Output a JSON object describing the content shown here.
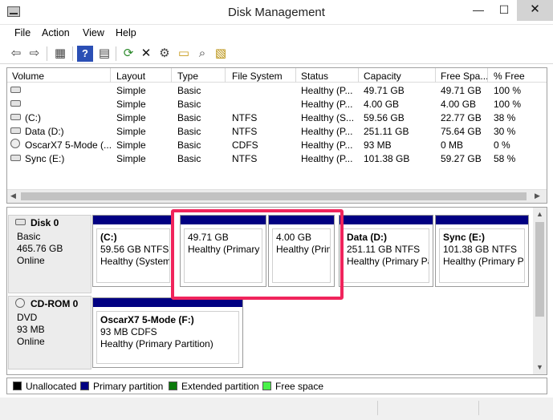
{
  "window": {
    "title": "Disk Management",
    "minimize": "—",
    "maximize": "☐",
    "close": "✕"
  },
  "menu": [
    "File",
    "Action",
    "View",
    "Help"
  ],
  "toolbar": [
    {
      "name": "back-arrow-icon",
      "glyph": "⇦"
    },
    {
      "name": "forward-arrow-icon",
      "glyph": "⇨"
    },
    {
      "name": "console-tree-icon",
      "glyph": "▦"
    },
    {
      "name": "help-icon",
      "glyph": "?"
    },
    {
      "name": "properties-sheet-icon",
      "glyph": "▤"
    },
    {
      "name": "refresh-icon",
      "glyph": "⟳"
    },
    {
      "name": "delete-icon",
      "glyph": "✕"
    },
    {
      "name": "settings-icon",
      "glyph": "⚙"
    },
    {
      "name": "open-folder-icon",
      "glyph": "▭"
    },
    {
      "name": "search-icon",
      "glyph": "⌕"
    },
    {
      "name": "rescan-disks-icon",
      "glyph": "▧"
    }
  ],
  "volumes": {
    "columns": [
      "Volume",
      "Layout",
      "Type",
      "File System",
      "Status",
      "Capacity",
      "Free Spa...",
      "% Free"
    ],
    "rows": [
      {
        "icon": "disk",
        "volume": "",
        "layout": "Simple",
        "type": "Basic",
        "fs": "",
        "status": "Healthy (P...",
        "capacity": "49.71 GB",
        "free": "49.71 GB",
        "pct": "100 %"
      },
      {
        "icon": "disk",
        "volume": "",
        "layout": "Simple",
        "type": "Basic",
        "fs": "",
        "status": "Healthy (P...",
        "capacity": "4.00 GB",
        "free": "4.00 GB",
        "pct": "100 %"
      },
      {
        "icon": "disk",
        "volume": "(C:)",
        "layout": "Simple",
        "type": "Basic",
        "fs": "NTFS",
        "status": "Healthy (S...",
        "capacity": "59.56 GB",
        "free": "22.77 GB",
        "pct": "38 %"
      },
      {
        "icon": "disk",
        "volume": "Data (D:)",
        "layout": "Simple",
        "type": "Basic",
        "fs": "NTFS",
        "status": "Healthy (P...",
        "capacity": "251.11 GB",
        "free": "75.64 GB",
        "pct": "30 %"
      },
      {
        "icon": "cd",
        "volume": "OscarX7 5-Mode (...",
        "layout": "Simple",
        "type": "Basic",
        "fs": "CDFS",
        "status": "Healthy (P...",
        "capacity": "93 MB",
        "free": "0 MB",
        "pct": "0 %"
      },
      {
        "icon": "disk",
        "volume": "Sync (E:)",
        "layout": "Simple",
        "type": "Basic",
        "fs": "NTFS",
        "status": "Healthy (P...",
        "capacity": "101.38 GB",
        "free": "59.27 GB",
        "pct": "58 %"
      }
    ]
  },
  "disks": [
    {
      "name": "Disk 0",
      "kind": "Basic",
      "size": "465.76 GB",
      "state": "Online",
      "partitions": [
        {
          "title": "(C:)",
          "size_fs": "59.56 GB NTFS",
          "status": "Healthy (System, Boot, Page File, Active, Crash Dump, Primary Partition)"
        },
        {
          "title": "",
          "size_fs": "49.71 GB",
          "status": "Healthy (Primary Partition)"
        },
        {
          "title": "",
          "size_fs": "4.00 GB",
          "status": "Healthy (Primary Partition)"
        },
        {
          "title": "Data  (D:)",
          "size_fs": "251.11 GB NTFS",
          "status": "Healthy (Primary Partition)"
        },
        {
          "title": "Sync  (E:)",
          "size_fs": "101.38 GB NTFS",
          "status": "Healthy (Primary Partition)"
        }
      ]
    },
    {
      "name": "CD-ROM 0",
      "kind": "DVD",
      "size": "93 MB",
      "state": "Online",
      "partitions": [
        {
          "title": "OscarX7 5-Mode  (F:)",
          "size_fs": "93 MB CDFS",
          "status": "Healthy (Primary Partition)"
        }
      ]
    }
  ],
  "legend": [
    {
      "label": "Unallocated",
      "color": "#000000"
    },
    {
      "label": "Primary partition",
      "color": "#010082"
    },
    {
      "label": "Extended partition",
      "color": "#0b7a0b"
    },
    {
      "label": "Free space",
      "color": "#4af24a"
    }
  ]
}
